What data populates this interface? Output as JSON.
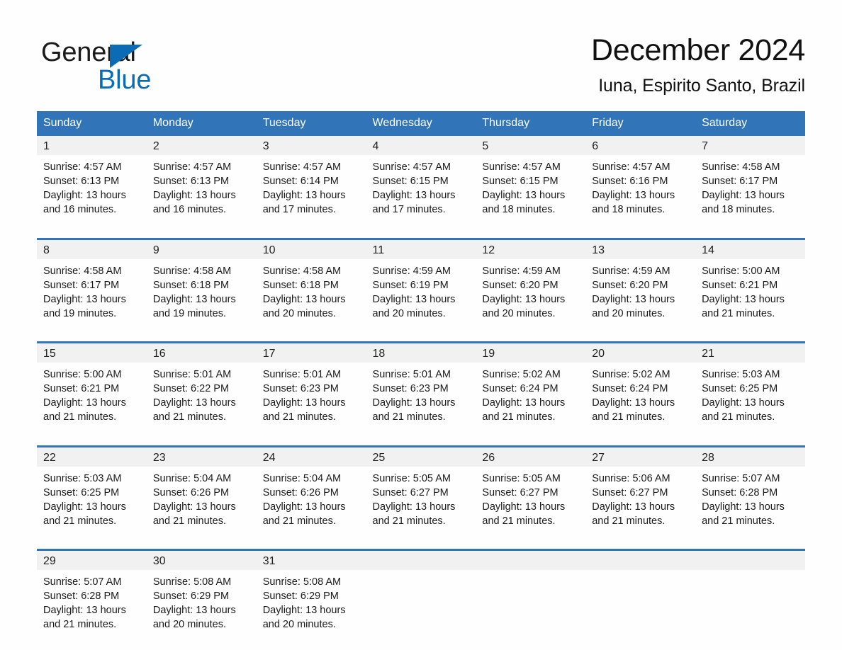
{
  "brand": {
    "logo_text_1": "General",
    "logo_text_2": "Blue",
    "triangle_icon": "triangle-icon",
    "accent_blue": "#0b6cb5"
  },
  "header": {
    "title": "December 2024",
    "subtitle": "Iuna, Espirito Santo, Brazil"
  },
  "colors": {
    "header_blue": "#3175b8",
    "daynum_gray": "#f1f1f1",
    "page_bg": "#fefefe",
    "text": "#1a1a1a"
  },
  "weekday_headers": [
    "Sunday",
    "Monday",
    "Tuesday",
    "Wednesday",
    "Thursday",
    "Friday",
    "Saturday"
  ],
  "weeks": [
    [
      {
        "day": "1",
        "sunrise": "Sunrise: 4:57 AM",
        "sunset": "Sunset: 6:13 PM",
        "daylight1": "Daylight: 13 hours",
        "daylight2": "and 16 minutes."
      },
      {
        "day": "2",
        "sunrise": "Sunrise: 4:57 AM",
        "sunset": "Sunset: 6:13 PM",
        "daylight1": "Daylight: 13 hours",
        "daylight2": "and 16 minutes."
      },
      {
        "day": "3",
        "sunrise": "Sunrise: 4:57 AM",
        "sunset": "Sunset: 6:14 PM",
        "daylight1": "Daylight: 13 hours",
        "daylight2": "and 17 minutes."
      },
      {
        "day": "4",
        "sunrise": "Sunrise: 4:57 AM",
        "sunset": "Sunset: 6:15 PM",
        "daylight1": "Daylight: 13 hours",
        "daylight2": "and 17 minutes."
      },
      {
        "day": "5",
        "sunrise": "Sunrise: 4:57 AM",
        "sunset": "Sunset: 6:15 PM",
        "daylight1": "Daylight: 13 hours",
        "daylight2": "and 18 minutes."
      },
      {
        "day": "6",
        "sunrise": "Sunrise: 4:57 AM",
        "sunset": "Sunset: 6:16 PM",
        "daylight1": "Daylight: 13 hours",
        "daylight2": "and 18 minutes."
      },
      {
        "day": "7",
        "sunrise": "Sunrise: 4:58 AM",
        "sunset": "Sunset: 6:17 PM",
        "daylight1": "Daylight: 13 hours",
        "daylight2": "and 18 minutes."
      }
    ],
    [
      {
        "day": "8",
        "sunrise": "Sunrise: 4:58 AM",
        "sunset": "Sunset: 6:17 PM",
        "daylight1": "Daylight: 13 hours",
        "daylight2": "and 19 minutes."
      },
      {
        "day": "9",
        "sunrise": "Sunrise: 4:58 AM",
        "sunset": "Sunset: 6:18 PM",
        "daylight1": "Daylight: 13 hours",
        "daylight2": "and 19 minutes."
      },
      {
        "day": "10",
        "sunrise": "Sunrise: 4:58 AM",
        "sunset": "Sunset: 6:18 PM",
        "daylight1": "Daylight: 13 hours",
        "daylight2": "and 20 minutes."
      },
      {
        "day": "11",
        "sunrise": "Sunrise: 4:59 AM",
        "sunset": "Sunset: 6:19 PM",
        "daylight1": "Daylight: 13 hours",
        "daylight2": "and 20 minutes."
      },
      {
        "day": "12",
        "sunrise": "Sunrise: 4:59 AM",
        "sunset": "Sunset: 6:20 PM",
        "daylight1": "Daylight: 13 hours",
        "daylight2": "and 20 minutes."
      },
      {
        "day": "13",
        "sunrise": "Sunrise: 4:59 AM",
        "sunset": "Sunset: 6:20 PM",
        "daylight1": "Daylight: 13 hours",
        "daylight2": "and 20 minutes."
      },
      {
        "day": "14",
        "sunrise": "Sunrise: 5:00 AM",
        "sunset": "Sunset: 6:21 PM",
        "daylight1": "Daylight: 13 hours",
        "daylight2": "and 21 minutes."
      }
    ],
    [
      {
        "day": "15",
        "sunrise": "Sunrise: 5:00 AM",
        "sunset": "Sunset: 6:21 PM",
        "daylight1": "Daylight: 13 hours",
        "daylight2": "and 21 minutes."
      },
      {
        "day": "16",
        "sunrise": "Sunrise: 5:01 AM",
        "sunset": "Sunset: 6:22 PM",
        "daylight1": "Daylight: 13 hours",
        "daylight2": "and 21 minutes."
      },
      {
        "day": "17",
        "sunrise": "Sunrise: 5:01 AM",
        "sunset": "Sunset: 6:23 PM",
        "daylight1": "Daylight: 13 hours",
        "daylight2": "and 21 minutes."
      },
      {
        "day": "18",
        "sunrise": "Sunrise: 5:01 AM",
        "sunset": "Sunset: 6:23 PM",
        "daylight1": "Daylight: 13 hours",
        "daylight2": "and 21 minutes."
      },
      {
        "day": "19",
        "sunrise": "Sunrise: 5:02 AM",
        "sunset": "Sunset: 6:24 PM",
        "daylight1": "Daylight: 13 hours",
        "daylight2": "and 21 minutes."
      },
      {
        "day": "20",
        "sunrise": "Sunrise: 5:02 AM",
        "sunset": "Sunset: 6:24 PM",
        "daylight1": "Daylight: 13 hours",
        "daylight2": "and 21 minutes."
      },
      {
        "day": "21",
        "sunrise": "Sunrise: 5:03 AM",
        "sunset": "Sunset: 6:25 PM",
        "daylight1": "Daylight: 13 hours",
        "daylight2": "and 21 minutes."
      }
    ],
    [
      {
        "day": "22",
        "sunrise": "Sunrise: 5:03 AM",
        "sunset": "Sunset: 6:25 PM",
        "daylight1": "Daylight: 13 hours",
        "daylight2": "and 21 minutes."
      },
      {
        "day": "23",
        "sunrise": "Sunrise: 5:04 AM",
        "sunset": "Sunset: 6:26 PM",
        "daylight1": "Daylight: 13 hours",
        "daylight2": "and 21 minutes."
      },
      {
        "day": "24",
        "sunrise": "Sunrise: 5:04 AM",
        "sunset": "Sunset: 6:26 PM",
        "daylight1": "Daylight: 13 hours",
        "daylight2": "and 21 minutes."
      },
      {
        "day": "25",
        "sunrise": "Sunrise: 5:05 AM",
        "sunset": "Sunset: 6:27 PM",
        "daylight1": "Daylight: 13 hours",
        "daylight2": "and 21 minutes."
      },
      {
        "day": "26",
        "sunrise": "Sunrise: 5:05 AM",
        "sunset": "Sunset: 6:27 PM",
        "daylight1": "Daylight: 13 hours",
        "daylight2": "and 21 minutes."
      },
      {
        "day": "27",
        "sunrise": "Sunrise: 5:06 AM",
        "sunset": "Sunset: 6:27 PM",
        "daylight1": "Daylight: 13 hours",
        "daylight2": "and 21 minutes."
      },
      {
        "day": "28",
        "sunrise": "Sunrise: 5:07 AM",
        "sunset": "Sunset: 6:28 PM",
        "daylight1": "Daylight: 13 hours",
        "daylight2": "and 21 minutes."
      }
    ],
    [
      {
        "day": "29",
        "sunrise": "Sunrise: 5:07 AM",
        "sunset": "Sunset: 6:28 PM",
        "daylight1": "Daylight: 13 hours",
        "daylight2": "and 21 minutes."
      },
      {
        "day": "30",
        "sunrise": "Sunrise: 5:08 AM",
        "sunset": "Sunset: 6:29 PM",
        "daylight1": "Daylight: 13 hours",
        "daylight2": "and 20 minutes."
      },
      {
        "day": "31",
        "sunrise": "Sunrise: 5:08 AM",
        "sunset": "Sunset: 6:29 PM",
        "daylight1": "Daylight: 13 hours",
        "daylight2": "and 20 minutes."
      },
      {
        "day": "",
        "sunrise": "",
        "sunset": "",
        "daylight1": "",
        "daylight2": ""
      },
      {
        "day": "",
        "sunrise": "",
        "sunset": "",
        "daylight1": "",
        "daylight2": ""
      },
      {
        "day": "",
        "sunrise": "",
        "sunset": "",
        "daylight1": "",
        "daylight2": ""
      },
      {
        "day": "",
        "sunrise": "",
        "sunset": "",
        "daylight1": "",
        "daylight2": ""
      }
    ]
  ]
}
